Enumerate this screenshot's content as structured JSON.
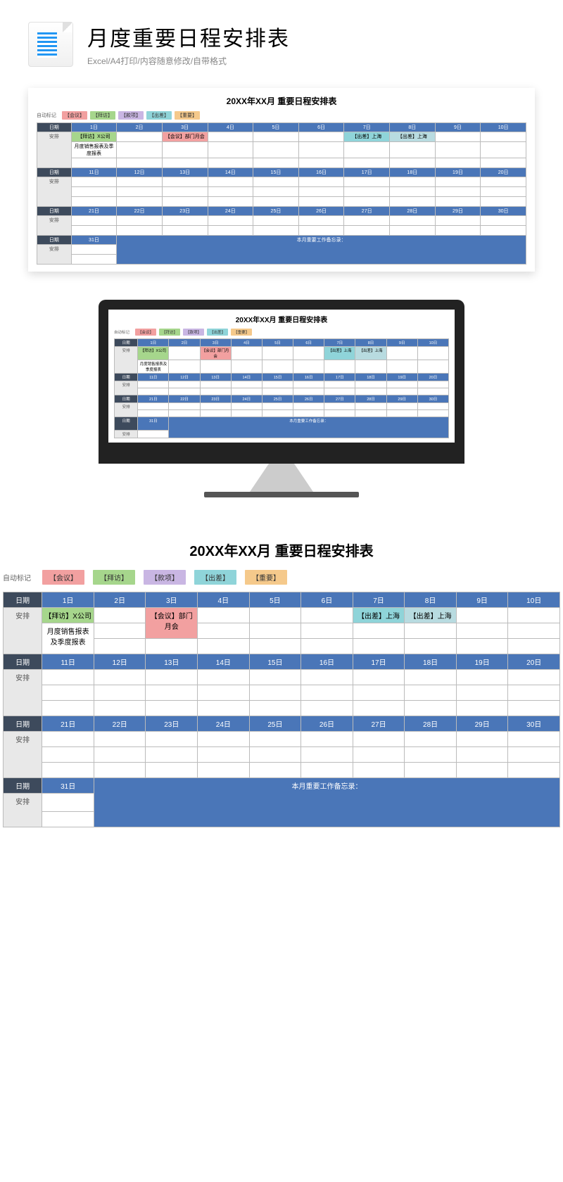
{
  "header": {
    "title": "月度重要日程安排表",
    "subtitle": "Excel/A4打印/内容随意修改/自带格式"
  },
  "schedule": {
    "title": "20XX年XX月 重要日程安排表",
    "auto_mark_label": "自动标记",
    "legend": {
      "meeting": "【会议】",
      "visit": "【拜访】",
      "money": "【款项】",
      "trip": "【出差】",
      "important": "【重要】"
    },
    "labels": {
      "date": "日期",
      "arrange": "安排",
      "memo": "本月重要工作备忘录："
    },
    "weeks": [
      {
        "days": [
          "1日",
          "2日",
          "3日",
          "4日",
          "5日",
          "6日",
          "7日",
          "8日",
          "9日",
          "10日"
        ]
      },
      {
        "days": [
          "11日",
          "12日",
          "13日",
          "14日",
          "15日",
          "16日",
          "17日",
          "18日",
          "19日",
          "20日"
        ]
      },
      {
        "days": [
          "21日",
          "22日",
          "23日",
          "24日",
          "25日",
          "26日",
          "27日",
          "28日",
          "29日",
          "30日"
        ]
      },
      {
        "days": [
          "31日"
        ]
      }
    ],
    "entries": {
      "d1_visit": "【拜访】X公司",
      "d1_report": "月度销售报表及季度报表",
      "d3_meeting": "【会议】部门月会",
      "d7_trip": "【出差】上海",
      "d8_trip": "【出差】上海"
    }
  }
}
